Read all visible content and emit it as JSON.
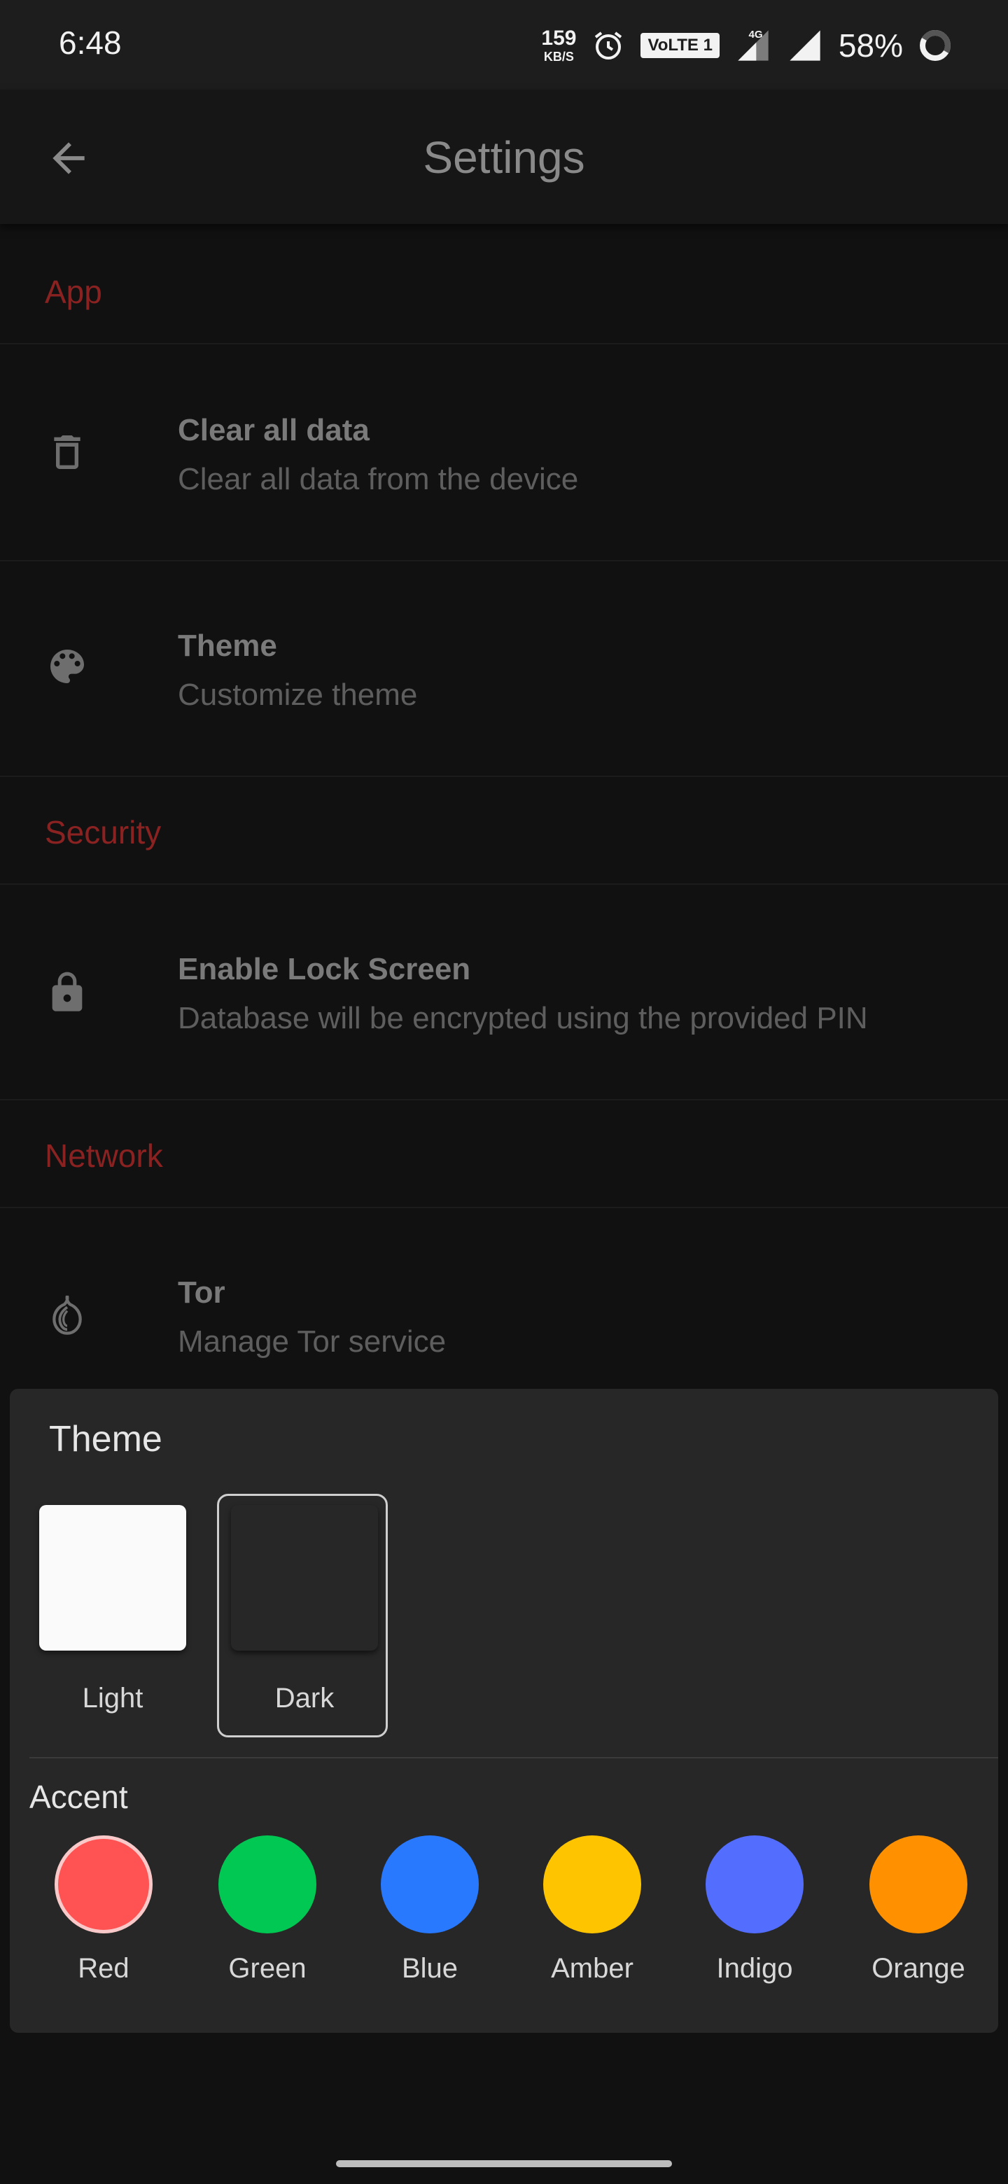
{
  "status_bar": {
    "time": "6:48",
    "net_speed_value": "159",
    "net_speed_unit": "KB/S",
    "volte_label": "VoLTE 1",
    "network_type": "4G",
    "battery_percent": "58%"
  },
  "app_bar": {
    "title": "Settings",
    "back_icon": "arrow-back-icon"
  },
  "sections": {
    "app": {
      "header": "App",
      "items": [
        {
          "icon": "trash-icon",
          "title": "Clear all data",
          "subtitle": "Clear all data from the device"
        },
        {
          "icon": "palette-icon",
          "title": "Theme",
          "subtitle": "Customize theme"
        }
      ]
    },
    "security": {
      "header": "Security",
      "items": [
        {
          "icon": "lock-icon",
          "title": "Enable Lock Screen",
          "subtitle": "Database will be encrypted using the provided PIN"
        }
      ]
    },
    "network": {
      "header": "Network",
      "items": [
        {
          "icon": "onion-icon",
          "title": "Tor",
          "subtitle": "Manage Tor service"
        }
      ]
    }
  },
  "theme_sheet": {
    "title": "Theme",
    "themes": [
      {
        "label": "Light",
        "selected": false,
        "color": "#fafafa"
      },
      {
        "label": "Dark",
        "selected": true,
        "color": "#272727"
      }
    ],
    "accent_title": "Accent",
    "accents": [
      {
        "label": "Red",
        "color": "#ff5252",
        "selected": true
      },
      {
        "label": "Green",
        "color": "#00c853",
        "selected": false
      },
      {
        "label": "Blue",
        "color": "#2979ff",
        "selected": false
      },
      {
        "label": "Amber",
        "color": "#ffc400",
        "selected": false
      },
      {
        "label": "Indigo",
        "color": "#536dfe",
        "selected": false
      },
      {
        "label": "Orange",
        "color": "#ff9100",
        "selected": false
      }
    ]
  },
  "colors": {
    "background": "#111111",
    "section_header": "#8b2222",
    "sheet_background": "#272727"
  }
}
